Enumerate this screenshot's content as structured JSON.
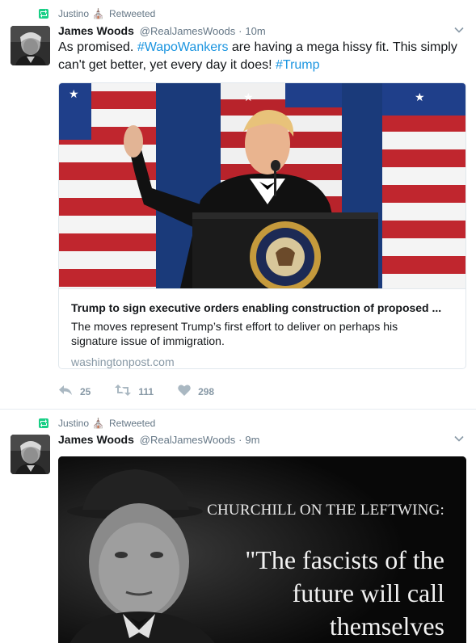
{
  "tweets": [
    {
      "retweeter": "Justino",
      "retweeter_emoji": "⛪",
      "retweet_label": "Retweeted",
      "author_name": "James Woods",
      "author_handle": "@RealJamesWoods",
      "separator": "·",
      "time": "10m",
      "text_parts": {
        "t1": "As promised. ",
        "h1": "#WapoWankers",
        "t2": " are having a mega hissy fit. This simply can't get better, yet every day it does! ",
        "h2": "#Trump"
      },
      "card": {
        "title": "Trump to sign executive orders enabling construction of proposed ...",
        "description": "The moves represent Trump’s first effort to deliver on perhaps his signature issue of immigration.",
        "domain": "washingtonpost.com"
      },
      "actions": {
        "replies": "25",
        "retweets": "111",
        "likes": "298"
      }
    },
    {
      "retweeter": "Justino",
      "retweeter_emoji": "⛪",
      "retweet_label": "Retweeted",
      "author_name": "James Woods",
      "author_handle": "@RealJamesWoods",
      "separator": "·",
      "time": "9m",
      "photo": {
        "heading": "CHURCHILL ON THE LEFTWING:",
        "quote": "\"The fascists of the future will call themselves"
      }
    }
  ],
  "colors": {
    "link": "#1b95e0",
    "retweet_green": "#19cf86",
    "muted": "#657786",
    "border": "#e1e8ed"
  },
  "icons": [
    "retweet-icon",
    "chevron-down-icon",
    "reply-icon",
    "retweet-action-icon",
    "heart-icon"
  ]
}
